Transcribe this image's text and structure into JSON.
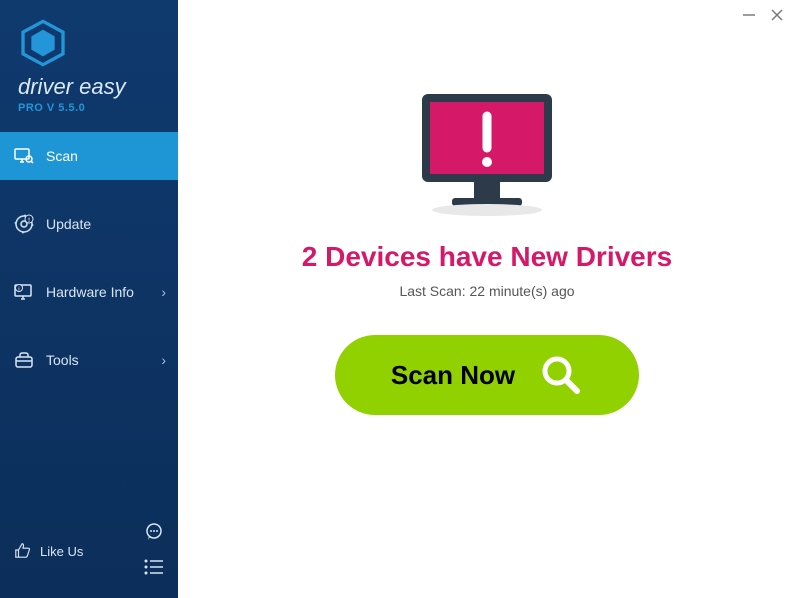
{
  "brand": {
    "name": "driver easy",
    "version": "PRO V 5.5.0"
  },
  "sidebar": {
    "items": [
      {
        "label": "Scan",
        "has_chevron": false,
        "active": true
      },
      {
        "label": "Update",
        "has_chevron": false,
        "active": false
      },
      {
        "label": "Hardware Info",
        "has_chevron": true,
        "active": false
      },
      {
        "label": "Tools",
        "has_chevron": true,
        "active": false
      }
    ],
    "like_label": "Like Us"
  },
  "main": {
    "heading": "2 Devices have New Drivers",
    "last_scan": "Last Scan: 22 minute(s) ago",
    "scan_button": "Scan Now"
  },
  "colors": {
    "accent": "#1e95d4",
    "alert": "#d61869",
    "action": "#91d100"
  }
}
